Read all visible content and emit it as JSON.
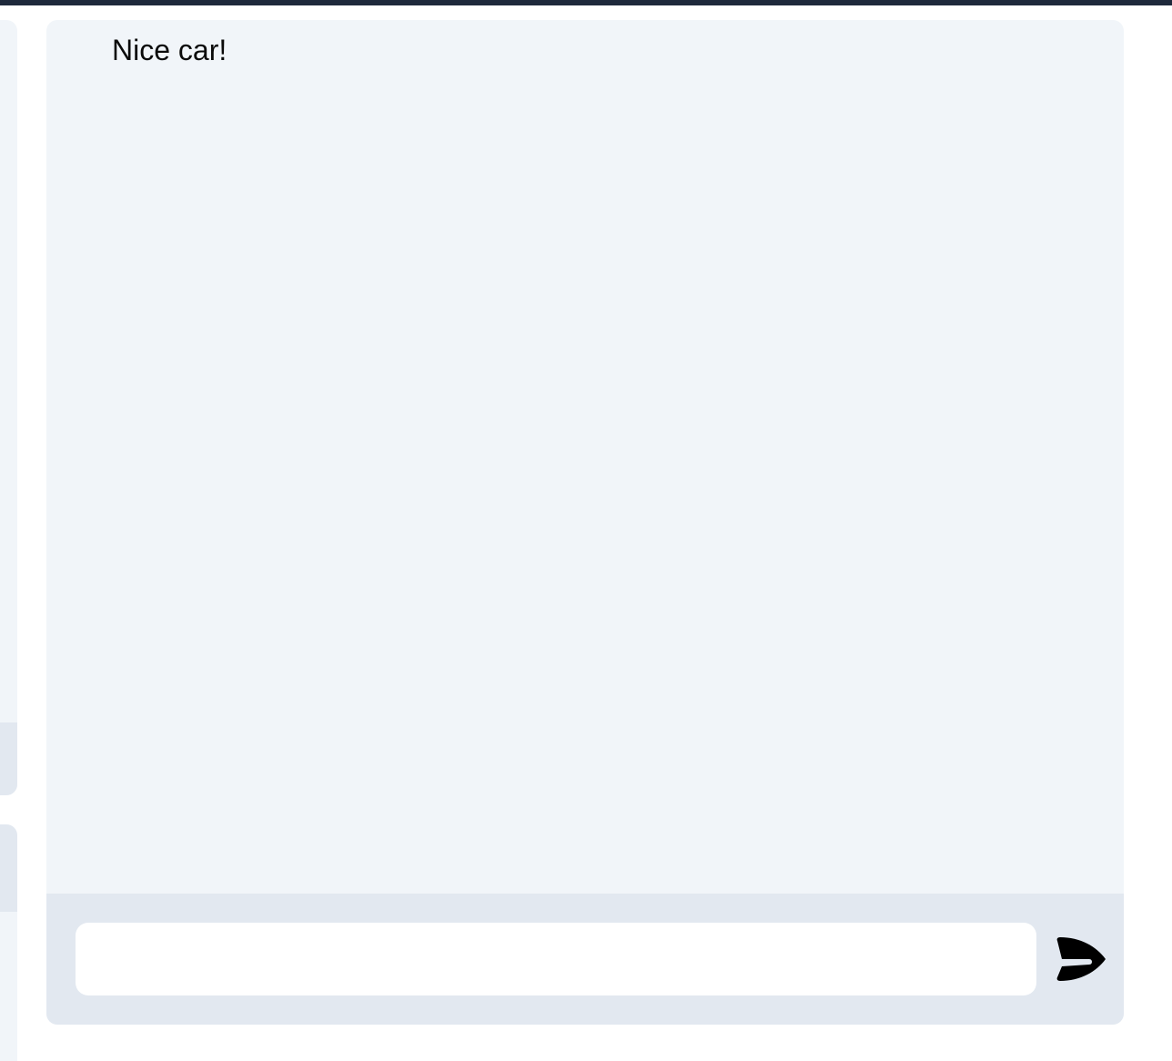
{
  "chat": {
    "messages": [
      {
        "text": "Nice car!"
      }
    ],
    "composer": {
      "value": "",
      "placeholder": "",
      "send_icon": "send-icon"
    }
  },
  "colors": {
    "top_bar": "#1e293b",
    "panel_background": "#f1f5f9",
    "composer_background": "#e2e8f0",
    "input_background": "#ffffff",
    "text": "#0b0b0b"
  }
}
